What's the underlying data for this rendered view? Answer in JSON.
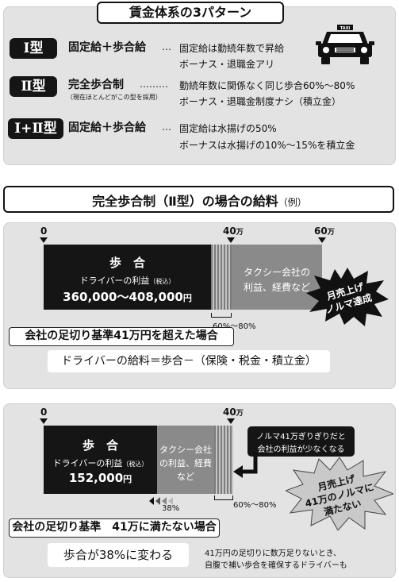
{
  "top": {
    "title": "賃金体系の3パターン",
    "types": [
      {
        "badge": "Ⅰ型",
        "name": "固定給＋歩合給",
        "dots": "…",
        "note": "",
        "desc1": "固定給は勤続年数で昇給",
        "desc2": "ボーナス・退職金アリ"
      },
      {
        "badge": "Ⅱ型",
        "name": "完全歩合制",
        "dots": "………",
        "note": "（現在ほとんどがこの型を採用）",
        "desc1": "勤続年数に関係なく同じ歩合60%～80%",
        "desc2": "ボーナス・退職金制度ナシ（積立金）"
      },
      {
        "badge": "Ⅰ+Ⅱ型",
        "name": "固定給＋歩合給",
        "dots": "…",
        "note": "",
        "desc1": "固定給は水揚げの50%",
        "desc2": "ボーナスは水揚げの10%～15%を積立金"
      }
    ],
    "taxi_sign": "TAXI"
  },
  "header2": {
    "title": "完全歩合制（Ⅱ型）の場合の給料",
    "suffix": "（例）"
  },
  "chart1": {
    "axis": {
      "zero": "0",
      "mid_num": "40",
      "mid_unit": "万",
      "max_num": "60",
      "max_unit": "万"
    },
    "black": {
      "title": "歩　合",
      "line1": "ドライバーの利益",
      "line1_small": "（税込）",
      "amount": "360,000～408,000",
      "amount_unit": "円"
    },
    "grey": {
      "line1": "タクシー会社の",
      "line2": "利益、経費など"
    },
    "range": "60%～80%",
    "burst": {
      "line1": "月売上げ",
      "line2": "ノルマ達成"
    },
    "case": "会社の足切り基準41万円を超えた場合",
    "formula": "ドライバーの給料＝歩合－（保険・税金・積立金）"
  },
  "chart2": {
    "axis": {
      "zero": "0",
      "mid_num": "40",
      "mid_unit": "万"
    },
    "black": {
      "title": "歩　合",
      "line1": "ドライバーの利益",
      "line1_small": "（税込）",
      "amount": "152,000",
      "amount_unit": "円"
    },
    "grey": {
      "line1": "タクシー会社",
      "line2": "の利益、経費",
      "line3": "など"
    },
    "callout": {
      "line1": "ノルマ41万ぎりぎりだと",
      "line2": "会社の利益が少なくなる"
    },
    "burst": {
      "line1": "月売上げ",
      "line2": "41万のノルマに",
      "line3": "満たない"
    },
    "pct": "38%",
    "range": "60%～80%",
    "case": "会社の足切り基準　41万に満たない場合",
    "result": "歩合が38%に変わる",
    "note1": "41万円の足切りに数万足りないとき、",
    "note2": "自腹で補い歩合を確保するドライバーも"
  }
}
